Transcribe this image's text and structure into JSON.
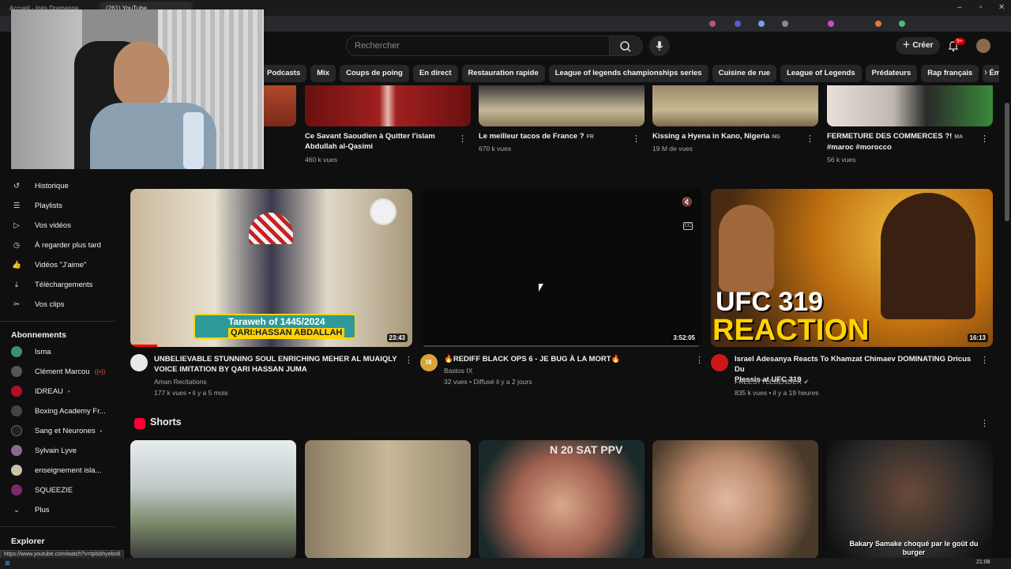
{
  "browser": {
    "tabs": [
      "Accueil - Inès Dramanne",
      "(261) YouTube"
    ],
    "status_url": "https://www.youtube.com/watch?v=tplsbhyebn8",
    "clock": "21:08"
  },
  "header": {
    "search_placeholder": "Rechercher",
    "create_label": "Créer",
    "notif_count": "9+"
  },
  "chips": [
    "Podcasts",
    "Mix",
    "Coups de poing",
    "En direct",
    "Restauration rapide",
    "League of legends championships series",
    "Cuisine de rue",
    "League of Legends",
    "Prédateurs",
    "Rap français",
    "Émissions de cuisine"
  ],
  "sidebar": {
    "you_items": [
      {
        "label": "Historique",
        "icon": "history-icon"
      },
      {
        "label": "Playlists",
        "icon": "playlists-icon"
      },
      {
        "label": "Vos vidéos",
        "icon": "your-videos-icon"
      },
      {
        "label": "À regarder plus tard",
        "icon": "watch-later-icon"
      },
      {
        "label": "Vidéos \"J'aime\"",
        "icon": "liked-icon"
      },
      {
        "label": "Téléchargements",
        "icon": "download-icon"
      },
      {
        "label": "Vos clips",
        "icon": "clips-icon"
      }
    ],
    "subs_heading": "Abonnements",
    "subs": [
      {
        "label": "Isma",
        "color": "#3a8f7a",
        "live": ""
      },
      {
        "label": "Clément Marcou",
        "color": "#555555",
        "live": "red"
      },
      {
        "label": "IDREAU",
        "color": "#b0102a",
        "live": "blue"
      },
      {
        "label": "Boxing Academy Fr...",
        "color": "#444444",
        "live": ""
      },
      {
        "label": "Sang et Neurones",
        "color": "#222222",
        "live": "blue"
      },
      {
        "label": "Sylvain Lyve",
        "color": "#8a6a8a",
        "live": ""
      },
      {
        "label": "enseignement isla...",
        "color": "#c9c3a8",
        "live": ""
      },
      {
        "label": "SQUEEZIE",
        "color": "#7a2a6a",
        "live": ""
      }
    ],
    "more_label": "Plus",
    "explore_heading": "Explorer"
  },
  "row1": [
    {
      "title_1": "Ce Savant Saoudien à Quitter l'islam",
      "title_2": "Abdullah al-Qasimi",
      "meta": "460 k vues",
      "flag": ""
    },
    {
      "title_1": "Le meilleur tacos de France ?",
      "title_2": "",
      "meta": "670 k vues",
      "flag": "FR"
    },
    {
      "title_1": "Kissing a Hyena in Kano, Nigeria",
      "title_2": "",
      "meta": "19 M de vues",
      "flag": "NG"
    },
    {
      "title_1": "FERMETURE DES COMMERCES ?!",
      "title_2": "#maroc #morocco",
      "meta": "56 k vues",
      "flag": "MA"
    }
  ],
  "row2": [
    {
      "title_1": "UNBELIEVABLE STUNNING SOUL ENRICHING MEHER AL MUAIQLY",
      "title_2": "VOICE IMITATION BY QARI HASSAN JUMA",
      "channel": "Aman Recitations",
      "meta": "177 k vues • il y a 5 mois",
      "duration": "23:43",
      "overlay_1": "Taraweh of 1445/2024",
      "overlay_2": "QARI:HASSAN ABDALLAH"
    },
    {
      "title_1": "🔥REDIFF BLACK OPS 6 - JE BUG À LA MORT🔥",
      "title_2": "",
      "channel": "Bastos IX",
      "meta": "32 vues • Diffusé il y a 2 jours",
      "duration": "3:52:05",
      "avatar_text": "IX"
    },
    {
      "title_1": "Israel Adesanya Reacts To Khamzat Chimaev DOMINATING Dricus Du",
      "title_2": "Plessis at UFC 319",
      "channel": "FREESTYLEBENDER",
      "meta": "835 k vues • il y a 19 heures",
      "duration": "16:13",
      "overlay_1": "UFC 319",
      "overlay_2": "REACTION"
    }
  ],
  "shorts": {
    "heading": "Shorts",
    "caption": "Bakary Samake choqué par le goût du burger",
    "poster_text": "N 20 SAT PPV"
  }
}
